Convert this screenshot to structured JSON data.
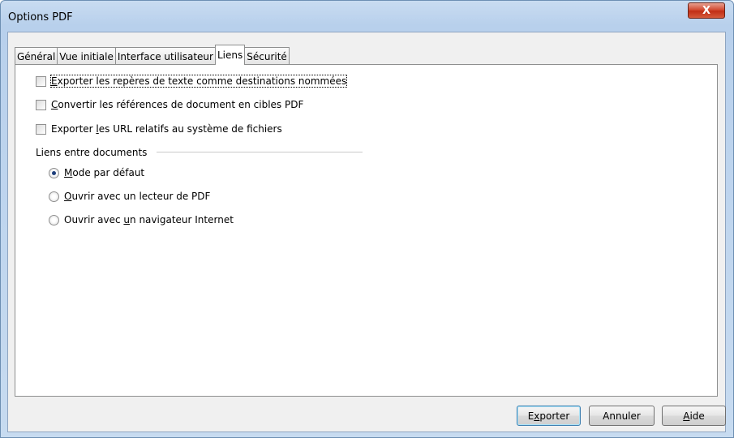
{
  "window": {
    "title": "Options PDF",
    "close_glyph": "X"
  },
  "tabs": [
    {
      "label": "Général",
      "active": false
    },
    {
      "label": "Vue initiale",
      "active": false
    },
    {
      "label": "Interface utilisateur",
      "active": false
    },
    {
      "label": "Liens",
      "active": true
    },
    {
      "label": "Sécurité",
      "active": false
    }
  ],
  "checkboxes": [
    {
      "mnemonic": "E",
      "rest": "xporter les repères de texte comme destinations nommées",
      "checked": false
    },
    {
      "mnemonic": "C",
      "rest": "onvertir les références de document en cibles PDF",
      "checked": false
    },
    {
      "pre": "Exporter ",
      "mnemonic": "l",
      "rest": "es URL relatifs au système de fichiers",
      "checked": false
    }
  ],
  "group": {
    "label": "Liens entre documents",
    "options": [
      {
        "pre": "",
        "mnemonic": "M",
        "rest": "ode par défaut",
        "checked": true
      },
      {
        "pre": "",
        "mnemonic": "O",
        "rest": "uvrir avec un lecteur de PDF",
        "checked": false
      },
      {
        "pre": "Ouvrir avec ",
        "mnemonic": "u",
        "rest": "n navigateur Internet",
        "checked": false
      }
    ]
  },
  "buttons": {
    "export": {
      "pre": "E",
      "mnemonic": "x",
      "rest": "porter"
    },
    "cancel": {
      "label": "Annuler"
    },
    "help": {
      "pre": "",
      "mnemonic": "A",
      "rest": "ide"
    }
  }
}
